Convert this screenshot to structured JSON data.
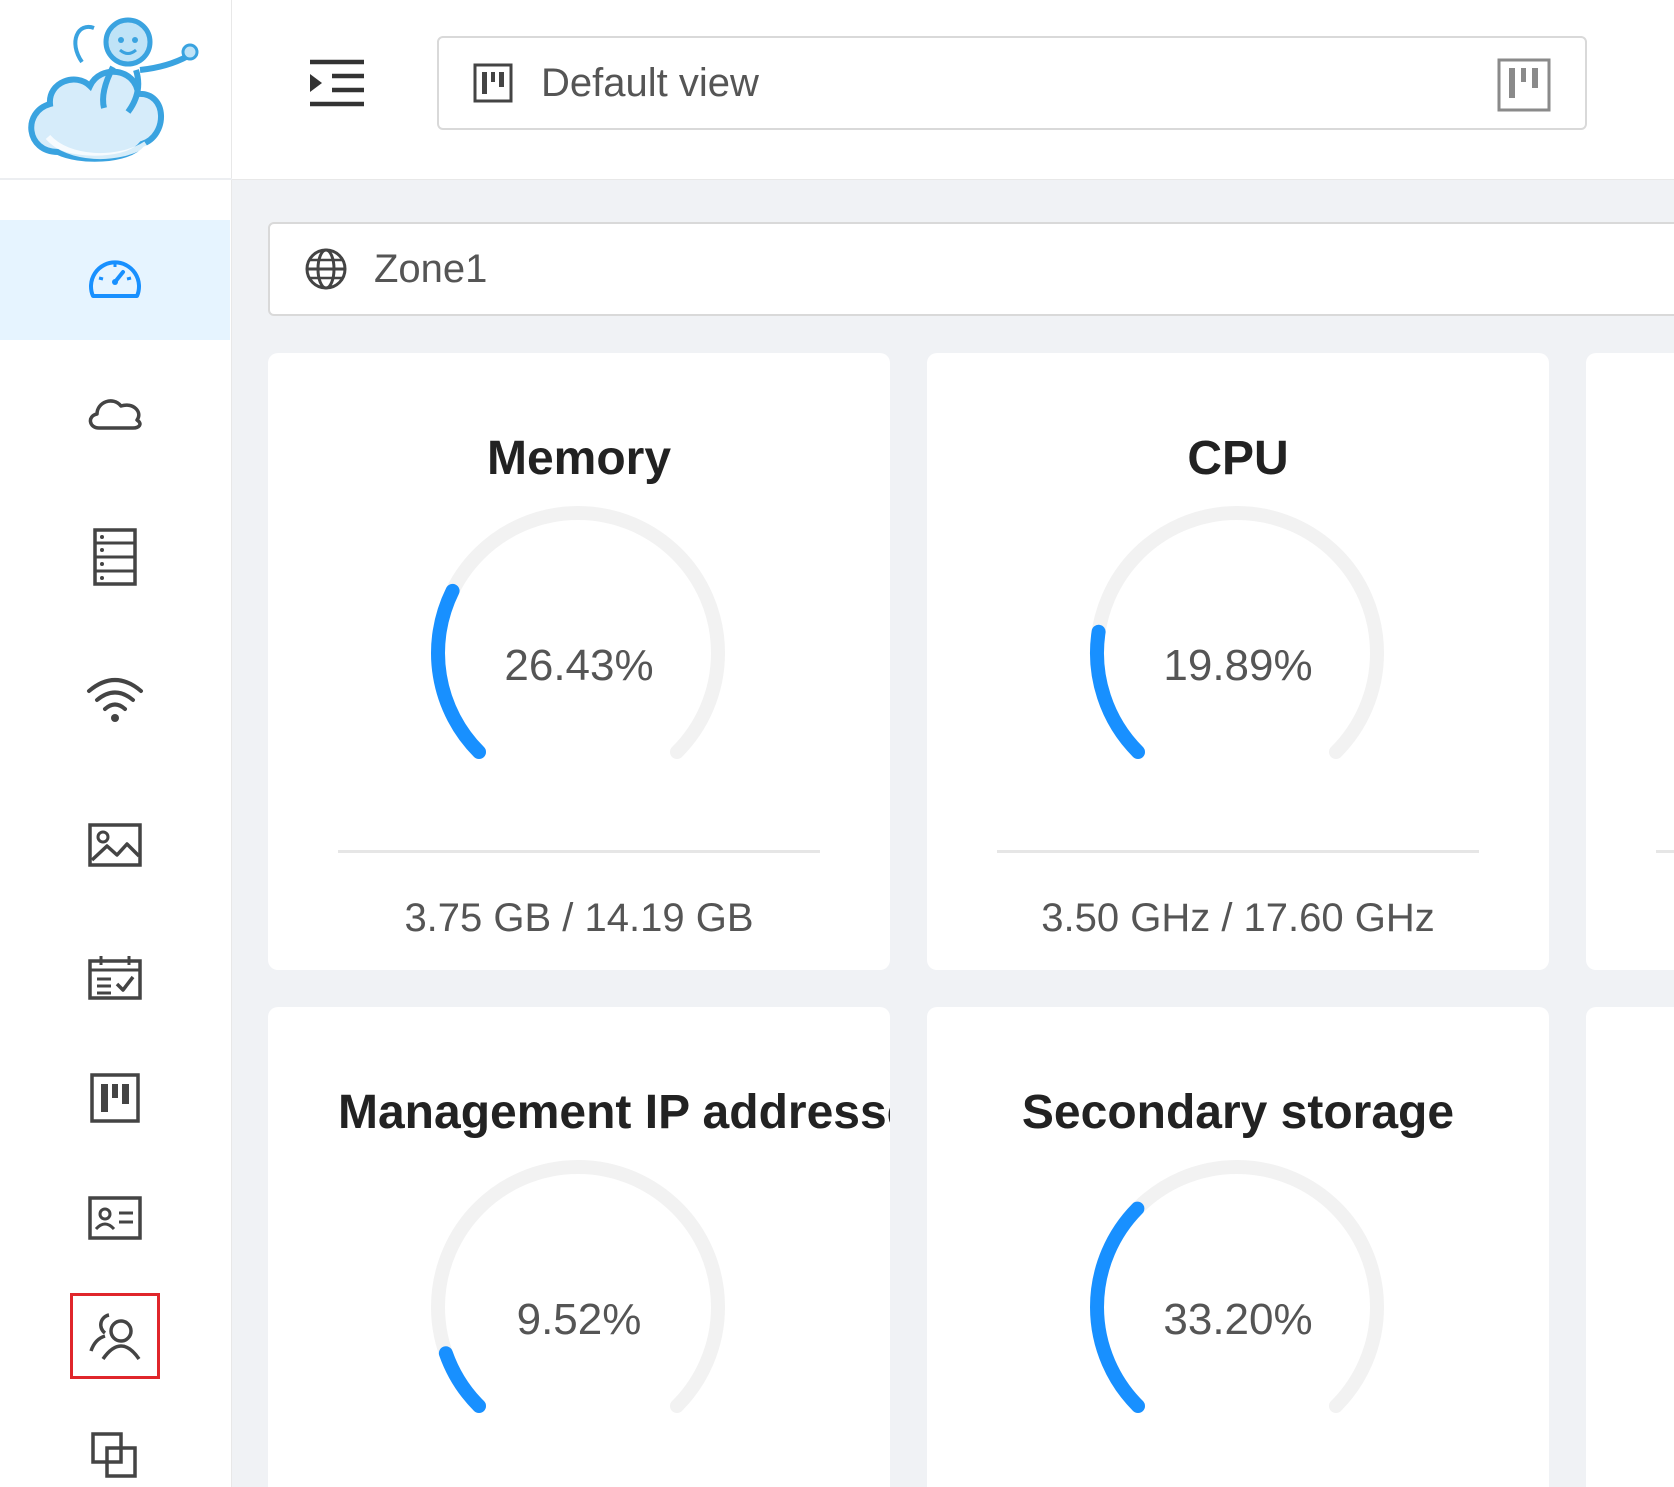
{
  "header": {
    "view_label": "Default view"
  },
  "zone": {
    "label": "Zone1"
  },
  "sidebar": {
    "items": [
      {
        "icon": "dashboard-icon",
        "active": true
      },
      {
        "icon": "cloud-icon"
      },
      {
        "icon": "server-icon"
      },
      {
        "icon": "wifi-icon"
      },
      {
        "icon": "image-icon"
      },
      {
        "icon": "calendar-check-icon"
      },
      {
        "icon": "project-board-icon"
      },
      {
        "icon": "id-card-icon"
      },
      {
        "icon": "users-icon",
        "highlighted": true
      },
      {
        "icon": "copy-icon"
      }
    ]
  },
  "cards": [
    {
      "title": "Memory",
      "percent_label": "26.43%",
      "value": 26.43,
      "detail": "3.75 GB / 14.19 GB"
    },
    {
      "title": "CPU",
      "percent_label": "19.89%",
      "value": 19.89,
      "detail": "3.50 GHz / 17.60 GHz"
    },
    {
      "title": "Management IP addresses",
      "percent_label": "9.52%",
      "value": 9.52,
      "detail": ""
    },
    {
      "title": "Secondary storage",
      "percent_label": "33.20%",
      "value": 33.2,
      "detail": ""
    }
  ],
  "colors": {
    "accent": "#1890ff",
    "track": "#f2f2f2",
    "highlight": "#e0262b",
    "active_bg": "#e6f4ff"
  }
}
